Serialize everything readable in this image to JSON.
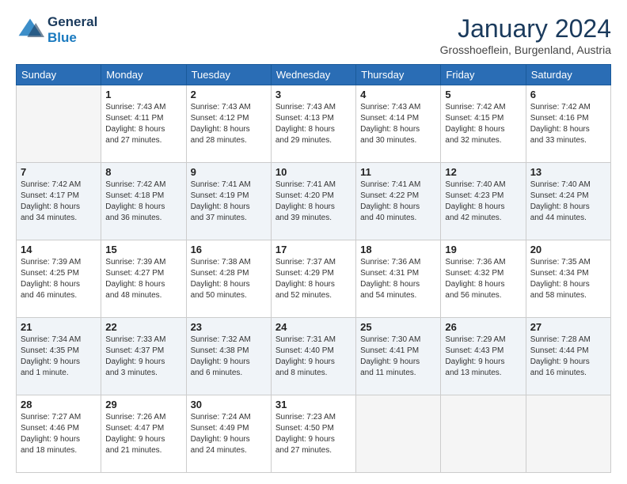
{
  "logo": {
    "line1": "General",
    "line2": "Blue"
  },
  "title": "January 2024",
  "subtitle": "Grosshoeflein, Burgenland, Austria",
  "headers": [
    "Sunday",
    "Monday",
    "Tuesday",
    "Wednesday",
    "Thursday",
    "Friday",
    "Saturday"
  ],
  "weeks": [
    [
      {
        "day": "",
        "lines": []
      },
      {
        "day": "1",
        "lines": [
          "Sunrise: 7:43 AM",
          "Sunset: 4:11 PM",
          "Daylight: 8 hours",
          "and 27 minutes."
        ]
      },
      {
        "day": "2",
        "lines": [
          "Sunrise: 7:43 AM",
          "Sunset: 4:12 PM",
          "Daylight: 8 hours",
          "and 28 minutes."
        ]
      },
      {
        "day": "3",
        "lines": [
          "Sunrise: 7:43 AM",
          "Sunset: 4:13 PM",
          "Daylight: 8 hours",
          "and 29 minutes."
        ]
      },
      {
        "day": "4",
        "lines": [
          "Sunrise: 7:43 AM",
          "Sunset: 4:14 PM",
          "Daylight: 8 hours",
          "and 30 minutes."
        ]
      },
      {
        "day": "5",
        "lines": [
          "Sunrise: 7:42 AM",
          "Sunset: 4:15 PM",
          "Daylight: 8 hours",
          "and 32 minutes."
        ]
      },
      {
        "day": "6",
        "lines": [
          "Sunrise: 7:42 AM",
          "Sunset: 4:16 PM",
          "Daylight: 8 hours",
          "and 33 minutes."
        ]
      }
    ],
    [
      {
        "day": "7",
        "lines": [
          "Sunrise: 7:42 AM",
          "Sunset: 4:17 PM",
          "Daylight: 8 hours",
          "and 34 minutes."
        ]
      },
      {
        "day": "8",
        "lines": [
          "Sunrise: 7:42 AM",
          "Sunset: 4:18 PM",
          "Daylight: 8 hours",
          "and 36 minutes."
        ]
      },
      {
        "day": "9",
        "lines": [
          "Sunrise: 7:41 AM",
          "Sunset: 4:19 PM",
          "Daylight: 8 hours",
          "and 37 minutes."
        ]
      },
      {
        "day": "10",
        "lines": [
          "Sunrise: 7:41 AM",
          "Sunset: 4:20 PM",
          "Daylight: 8 hours",
          "and 39 minutes."
        ]
      },
      {
        "day": "11",
        "lines": [
          "Sunrise: 7:41 AM",
          "Sunset: 4:22 PM",
          "Daylight: 8 hours",
          "and 40 minutes."
        ]
      },
      {
        "day": "12",
        "lines": [
          "Sunrise: 7:40 AM",
          "Sunset: 4:23 PM",
          "Daylight: 8 hours",
          "and 42 minutes."
        ]
      },
      {
        "day": "13",
        "lines": [
          "Sunrise: 7:40 AM",
          "Sunset: 4:24 PM",
          "Daylight: 8 hours",
          "and 44 minutes."
        ]
      }
    ],
    [
      {
        "day": "14",
        "lines": [
          "Sunrise: 7:39 AM",
          "Sunset: 4:25 PM",
          "Daylight: 8 hours",
          "and 46 minutes."
        ]
      },
      {
        "day": "15",
        "lines": [
          "Sunrise: 7:39 AM",
          "Sunset: 4:27 PM",
          "Daylight: 8 hours",
          "and 48 minutes."
        ]
      },
      {
        "day": "16",
        "lines": [
          "Sunrise: 7:38 AM",
          "Sunset: 4:28 PM",
          "Daylight: 8 hours",
          "and 50 minutes."
        ]
      },
      {
        "day": "17",
        "lines": [
          "Sunrise: 7:37 AM",
          "Sunset: 4:29 PM",
          "Daylight: 8 hours",
          "and 52 minutes."
        ]
      },
      {
        "day": "18",
        "lines": [
          "Sunrise: 7:36 AM",
          "Sunset: 4:31 PM",
          "Daylight: 8 hours",
          "and 54 minutes."
        ]
      },
      {
        "day": "19",
        "lines": [
          "Sunrise: 7:36 AM",
          "Sunset: 4:32 PM",
          "Daylight: 8 hours",
          "and 56 minutes."
        ]
      },
      {
        "day": "20",
        "lines": [
          "Sunrise: 7:35 AM",
          "Sunset: 4:34 PM",
          "Daylight: 8 hours",
          "and 58 minutes."
        ]
      }
    ],
    [
      {
        "day": "21",
        "lines": [
          "Sunrise: 7:34 AM",
          "Sunset: 4:35 PM",
          "Daylight: 9 hours",
          "and 1 minute."
        ]
      },
      {
        "day": "22",
        "lines": [
          "Sunrise: 7:33 AM",
          "Sunset: 4:37 PM",
          "Daylight: 9 hours",
          "and 3 minutes."
        ]
      },
      {
        "day": "23",
        "lines": [
          "Sunrise: 7:32 AM",
          "Sunset: 4:38 PM",
          "Daylight: 9 hours",
          "and 6 minutes."
        ]
      },
      {
        "day": "24",
        "lines": [
          "Sunrise: 7:31 AM",
          "Sunset: 4:40 PM",
          "Daylight: 9 hours",
          "and 8 minutes."
        ]
      },
      {
        "day": "25",
        "lines": [
          "Sunrise: 7:30 AM",
          "Sunset: 4:41 PM",
          "Daylight: 9 hours",
          "and 11 minutes."
        ]
      },
      {
        "day": "26",
        "lines": [
          "Sunrise: 7:29 AM",
          "Sunset: 4:43 PM",
          "Daylight: 9 hours",
          "and 13 minutes."
        ]
      },
      {
        "day": "27",
        "lines": [
          "Sunrise: 7:28 AM",
          "Sunset: 4:44 PM",
          "Daylight: 9 hours",
          "and 16 minutes."
        ]
      }
    ],
    [
      {
        "day": "28",
        "lines": [
          "Sunrise: 7:27 AM",
          "Sunset: 4:46 PM",
          "Daylight: 9 hours",
          "and 18 minutes."
        ]
      },
      {
        "day": "29",
        "lines": [
          "Sunrise: 7:26 AM",
          "Sunset: 4:47 PM",
          "Daylight: 9 hours",
          "and 21 minutes."
        ]
      },
      {
        "day": "30",
        "lines": [
          "Sunrise: 7:24 AM",
          "Sunset: 4:49 PM",
          "Daylight: 9 hours",
          "and 24 minutes."
        ]
      },
      {
        "day": "31",
        "lines": [
          "Sunrise: 7:23 AM",
          "Sunset: 4:50 PM",
          "Daylight: 9 hours",
          "and 27 minutes."
        ]
      },
      {
        "day": "",
        "lines": []
      },
      {
        "day": "",
        "lines": []
      },
      {
        "day": "",
        "lines": []
      }
    ]
  ]
}
